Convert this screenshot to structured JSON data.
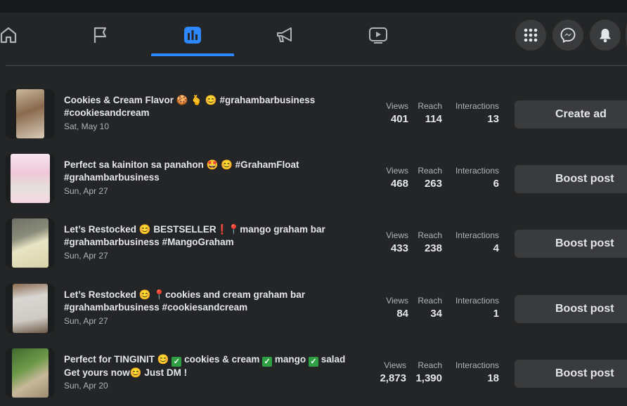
{
  "nav": {
    "tabs": [
      {
        "icon": "home-icon"
      },
      {
        "icon": "flag-icon"
      },
      {
        "icon": "insights-icon",
        "active": true
      },
      {
        "icon": "megaphone-icon"
      },
      {
        "icon": "video-icon"
      }
    ],
    "right_buttons": [
      "menu-grid-icon",
      "messenger-icon",
      "notifications-icon"
    ]
  },
  "labels": {
    "views": "Views",
    "reach": "Reach",
    "interactions": "Interactions"
  },
  "posts": [
    {
      "title_line1": "Cookies & Cream Flavor 🍪 🫰 😊 #grahambarbusiness",
      "title_line2": "#cookiesandcream",
      "date": "Sat, May 10",
      "views": "401",
      "reach": "114",
      "interactions": "13",
      "action": "Create ad"
    },
    {
      "title_line1": "Perfect sa kainiton sa panahon 🤩 😊 #GrahamFloat",
      "title_line2": "#grahambarbusiness",
      "date": "Sun, Apr 27",
      "views": "468",
      "reach": "263",
      "interactions": "6",
      "action": "Boost post"
    },
    {
      "title_line1": "Let’s Restocked 😊 BESTSELLER❗📍mango graham bar",
      "title_line2": "#grahambarbusiness #MangoGraham",
      "date": "Sun, Apr 27",
      "views": "433",
      "reach": "238",
      "interactions": "4",
      "action": "Boost post"
    },
    {
      "title_line1": "Let’s Restocked 😊 📍cookies and cream graham bar",
      "title_line2": "#grahambarbusiness #cookiesandcream",
      "date": "Sun, Apr 27",
      "views": "84",
      "reach": "34",
      "interactions": "1",
      "action": "Boost post"
    },
    {
      "title_line1_parts": [
        "Perfect for TINGINIT 😊 ",
        "cookies & cream ",
        "mango ",
        "salad"
      ],
      "title_line2": "Get yours now😊 Just DM !",
      "date": "Sun, Apr 20",
      "views": "2,873",
      "reach": "1,390",
      "interactions": "18",
      "action": "Boost post"
    }
  ],
  "thumb_colors": [
    "#8a6a4e",
    "#f0c8d8",
    "#7a7d6a",
    "#cfcac4",
    "#4f7a3a"
  ]
}
